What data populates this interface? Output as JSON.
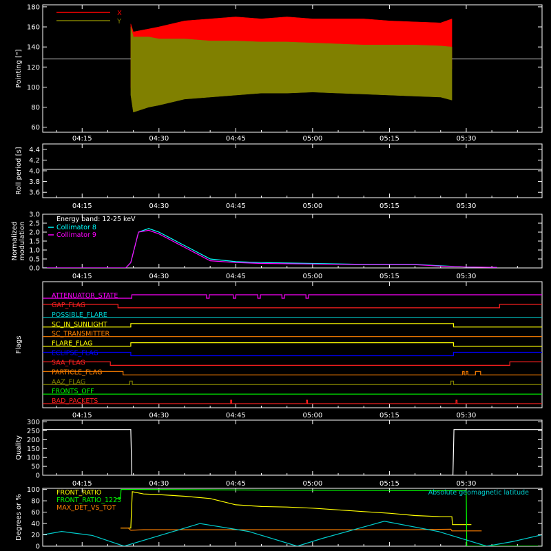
{
  "time_axis": {
    "ticks": [
      "04:15",
      "04:30",
      "04:45",
      "05:00",
      "05:15",
      "05:30"
    ],
    "tick_minutes": [
      255,
      270,
      285,
      300,
      315,
      330
    ],
    "range_minutes": [
      247.3,
      344.8
    ]
  },
  "chart_data": [
    {
      "type": "area",
      "panel": "pointing",
      "ylabel": "Pointing [\"]",
      "ylim": [
        55,
        182
      ],
      "yticks": [
        60,
        80,
        100,
        120,
        140,
        160,
        180
      ],
      "reference_line": 128,
      "legend": "top-left",
      "series": [
        {
          "name": "X",
          "color": "#ff0000",
          "x": [
            264.5,
            265,
            268,
            270,
            275,
            280,
            285,
            290,
            295,
            300,
            305,
            310,
            315,
            320,
            325,
            327.2
          ],
          "upper": [
            163,
            155,
            158,
            160,
            166,
            168,
            170,
            168,
            170,
            168,
            168,
            168,
            166,
            165,
            164,
            168
          ],
          "lower": [
            100,
            78,
            92,
            96,
            104,
            106,
            108,
            108,
            110,
            112,
            113,
            114,
            115,
            116,
            116,
            118
          ]
        },
        {
          "name": "Y",
          "color": "#808000",
          "x": [
            264.5,
            265,
            268,
            270,
            275,
            280,
            285,
            290,
            295,
            300,
            305,
            310,
            315,
            320,
            325,
            327.2
          ],
          "upper": [
            160,
            150,
            150,
            148,
            148,
            146,
            146,
            145,
            145,
            144,
            143,
            142,
            142,
            142,
            141,
            140
          ],
          "lower": [
            92,
            75,
            80,
            82,
            88,
            90,
            92,
            94,
            94,
            95,
            94,
            93,
            92,
            91,
            90,
            87
          ]
        }
      ]
    },
    {
      "type": "line",
      "panel": "roll_period",
      "ylabel": "Roll period [s]",
      "ylim": [
        3.5,
        4.5
      ],
      "yticks": [
        3.6,
        3.8,
        4.0,
        4.2,
        4.4
      ],
      "series": [
        {
          "name": "",
          "color": "#ffffff",
          "x": [
            247.3,
            344.8
          ],
          "y": [
            4.03,
            4.03
          ]
        }
      ]
    },
    {
      "type": "line",
      "panel": "modulation",
      "ylabel": "Normalized modulation",
      "ylim": [
        0,
        3
      ],
      "yticks": [
        0.0,
        0.5,
        1.0,
        1.5,
        2.0,
        2.5,
        3.0
      ],
      "annotation": "Energy band: 12-25 keV",
      "series": [
        {
          "name": "Collimator 8",
          "color": "#00ffff",
          "x": [
            247.3,
            263.5,
            264.5,
            266,
            268,
            270,
            272,
            274,
            276,
            278,
            280,
            285,
            290,
            300,
            310,
            320,
            325,
            330,
            336
          ],
          "y": [
            0,
            0,
            0.3,
            2.0,
            2.2,
            2.0,
            1.7,
            1.4,
            1.1,
            0.8,
            0.5,
            0.35,
            0.3,
            0.25,
            0.2,
            0.2,
            0.12,
            0.05,
            0.03
          ]
        },
        {
          "name": "Collimator 9",
          "color": "#ff00ff",
          "x": [
            247.3,
            263.5,
            264.5,
            266,
            268,
            270,
            272,
            274,
            276,
            278,
            280,
            285,
            290,
            300,
            310,
            320,
            325,
            330,
            336
          ],
          "y": [
            0,
            0,
            0.3,
            2.0,
            2.1,
            1.9,
            1.6,
            1.3,
            1.0,
            0.7,
            0.4,
            0.3,
            0.25,
            0.22,
            0.18,
            0.18,
            0.1,
            0.05,
            0.03
          ]
        }
      ]
    },
    {
      "type": "line",
      "panel": "flags",
      "ylabel": "Flags",
      "series": [
        {
          "name": "ATTENUATOR_STATE",
          "color": "#ff00ff",
          "x": [
            247.3,
            264.7,
            264.7,
            279.3,
            279.3,
            279.8,
            279.8,
            284.5,
            284.5,
            285,
            285,
            289.3,
            289.3,
            289.8,
            289.8,
            294,
            294,
            294.5,
            294.5,
            298.7,
            298.7,
            299.2,
            299.2,
            344.8
          ],
          "y": [
            0,
            0,
            1,
            1,
            0,
            0,
            1,
            1,
            0,
            0,
            1,
            1,
            0,
            0,
            1,
            1,
            0,
            0,
            1,
            1,
            0,
            0,
            1,
            1
          ]
        },
        {
          "name": "GAP_FLAG",
          "color": "#ff2020",
          "x": [
            247.3,
            262,
            262,
            336.5,
            336.5,
            344.8
          ],
          "y": [
            1,
            1,
            0,
            0,
            1,
            1
          ]
        },
        {
          "name": "POSSIBLE_FLARE",
          "color": "#00cccc",
          "x": [
            247.3,
            344.8
          ],
          "y": [
            0,
            0
          ]
        },
        {
          "name": "SC_IN_SUNLIGHT",
          "color": "#ffff00",
          "x": [
            247.3,
            264.5,
            264.5,
            327.5,
            327.5,
            344.8
          ],
          "y": [
            0,
            0,
            1,
            1,
            0,
            0
          ]
        },
        {
          "name": "SC_TRANSMITTER",
          "color": "#ff8000",
          "x": [
            247.3,
            344.8
          ],
          "y": [
            0,
            0
          ]
        },
        {
          "name": "FLARE_FLAG",
          "color": "#ffff00",
          "x": [
            247.3,
            264.5,
            264.5,
            327.5,
            327.5,
            344.8
          ],
          "y": [
            0,
            0,
            1,
            1,
            0,
            0
          ]
        },
        {
          "name": "ECLIPSE_FLAG",
          "color": "#0000ff",
          "x": [
            247.3,
            264.5,
            264.5,
            327.5,
            327.5,
            344.8
          ],
          "y": [
            1,
            1,
            0,
            0,
            1,
            1
          ]
        },
        {
          "name": "SAA_FLAG",
          "color": "#ff2020",
          "x": [
            247.3,
            260.5,
            260.5,
            338.5,
            338.5,
            344.8
          ],
          "y": [
            1,
            1,
            0,
            0,
            1,
            1
          ]
        },
        {
          "name": "PARTICLE_FLAG",
          "color": "#ff8000",
          "x": [
            247.3,
            263,
            263,
            329.3,
            329.3,
            329.6,
            329.6,
            330,
            330,
            330.3,
            330.3,
            331.8,
            331.8,
            332.8,
            332.8,
            344.8
          ],
          "y": [
            1,
            1,
            0,
            0,
            1,
            1,
            0,
            0,
            1,
            1,
            0,
            0,
            1,
            1,
            0,
            0
          ]
        },
        {
          "name": "AAZ_FLAG",
          "color": "#808000",
          "x": [
            247.3,
            264.3,
            264.3,
            264.8,
            264.8,
            327,
            327,
            327.5,
            327.5,
            344.8
          ],
          "y": [
            0,
            0,
            1,
            1,
            0,
            0,
            1,
            1,
            0,
            0
          ]
        },
        {
          "name": "FRONTS_OFF",
          "color": "#00ff00",
          "x": [
            247.3,
            344.8
          ],
          "y": [
            0,
            0
          ]
        },
        {
          "name": "BAD_PACKETS",
          "color": "#ff2020",
          "x": [
            247.3,
            284,
            284,
            284.2,
            284.2,
            298.8,
            298.8,
            299,
            299,
            328,
            328,
            328.2,
            328.2,
            344.8
          ],
          "y": [
            0,
            0,
            1,
            1,
            0,
            0,
            1,
            1,
            0,
            0,
            1,
            1,
            0,
            0
          ]
        }
      ]
    },
    {
      "type": "line",
      "panel": "quality",
      "ylabel": "Quality",
      "ylim": [
        0,
        310
      ],
      "yticks": [
        0,
        50,
        100,
        150,
        200,
        250,
        300
      ],
      "series": [
        {
          "name": "",
          "color": "#ffffff",
          "x": [
            247.3,
            264.5,
            264.7,
            327.4,
            327.6,
            344.8
          ],
          "y": [
            257,
            257,
            0,
            0,
            257,
            257
          ]
        }
      ]
    },
    {
      "type": "line",
      "panel": "front_ratio",
      "ylabel": "Degrees or %",
      "ylim": [
        0,
        102
      ],
      "yticks": [
        0,
        20,
        40,
        60,
        80,
        100
      ],
      "series": [
        {
          "name": "FRONT_RATIO",
          "color": "#ffff00",
          "x": [
            262.5,
            264.5,
            264.8,
            267,
            270,
            275,
            280,
            285,
            290,
            295,
            300,
            305,
            310,
            315,
            320,
            325,
            327.2,
            327.3,
            331
          ],
          "y": [
            32,
            32,
            96,
            92,
            91,
            88,
            84,
            73,
            70,
            69,
            67,
            64,
            61,
            58,
            54,
            52,
            52,
            38,
            38
          ]
        },
        {
          "name": "FRONT_RATIO_1223",
          "color": "#00ff00",
          "x": [
            261.5,
            262.5,
            262.6,
            264.7,
            264.8,
            290,
            327.2,
            330,
            330.1,
            344.8
          ],
          "y": [
            84,
            84,
            100,
            100,
            100,
            99,
            98,
            98,
            0,
            0
          ]
        },
        {
          "name": "MAX_DET_VS_TOT",
          "color": "#ff8000",
          "x": [
            262.5,
            264,
            264.5,
            267,
            280,
            300,
            320,
            327,
            327.2,
            333
          ],
          "y": [
            32,
            32,
            28,
            29,
            29,
            29,
            29,
            30,
            27,
            27
          ]
        },
        {
          "name": "Absolute geomagnetic latitude",
          "color": "#00cccc",
          "x": [
            247.3,
            251,
            257,
            263.2,
            278,
            287.5,
            297,
            302,
            314,
            324.5,
            334,
            339,
            344.8
          ],
          "y": [
            20,
            26,
            19,
            0,
            40,
            26,
            0,
            14,
            44,
            26,
            0,
            8,
            20
          ]
        }
      ]
    }
  ]
}
